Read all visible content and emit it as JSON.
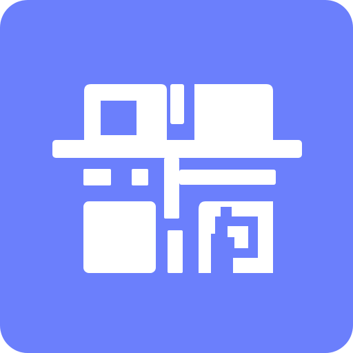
{
  "icon": {
    "name": "qr-code-scanner-icon",
    "background_color": "#6B7FFC",
    "glyph_color": "#FFFFFF"
  }
}
